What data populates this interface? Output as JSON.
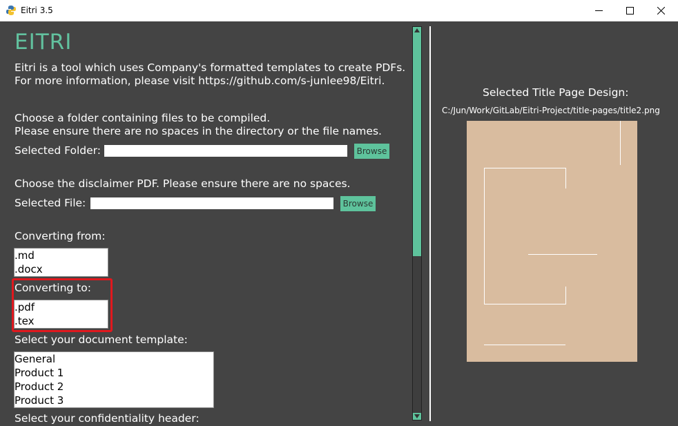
{
  "window": {
    "title": "Eitri 3.5",
    "minimize": "—",
    "maximize": "☐",
    "close": "✕"
  },
  "main": {
    "heading": "EITRI",
    "intro_line1": "Eitri is a tool which uses Company's formatted templates to create PDFs.",
    "intro_line2": "For more information, please visit https://github.com/s-junlee98/Eitri.",
    "folder_prompt1": "Choose a folder containing files to be compiled.",
    "folder_prompt2": "Please ensure there are no spaces in the directory or the file names.",
    "folder_label": "Selected Folder:",
    "folder_value": "",
    "browse_label": "Browse",
    "disclaimer_prompt": "Choose the disclaimer PDF. Please ensure there are no spaces.",
    "file_label": "Selected File:",
    "file_value": "",
    "converting_from_label": "Converting from:",
    "converting_from_options": [
      ".md",
      ".docx"
    ],
    "converting_to_label": "Converting to:",
    "converting_to_options": [
      ".pdf",
      ".tex"
    ],
    "template_label": "Select your document template:",
    "template_options": [
      "General",
      "Product 1",
      "Product 2",
      "Product 3"
    ],
    "confidentiality_label": "Select your confidentiality header:"
  },
  "preview": {
    "title": "Selected Title Page Design:",
    "path": "C:/Jun/Work/GitLab/Eitri-Project/title-pages/title2.png",
    "background_color": "#d9bc9f"
  },
  "colors": {
    "accent": "#5ec39c",
    "background": "#444444",
    "highlight": "#e0181e"
  }
}
